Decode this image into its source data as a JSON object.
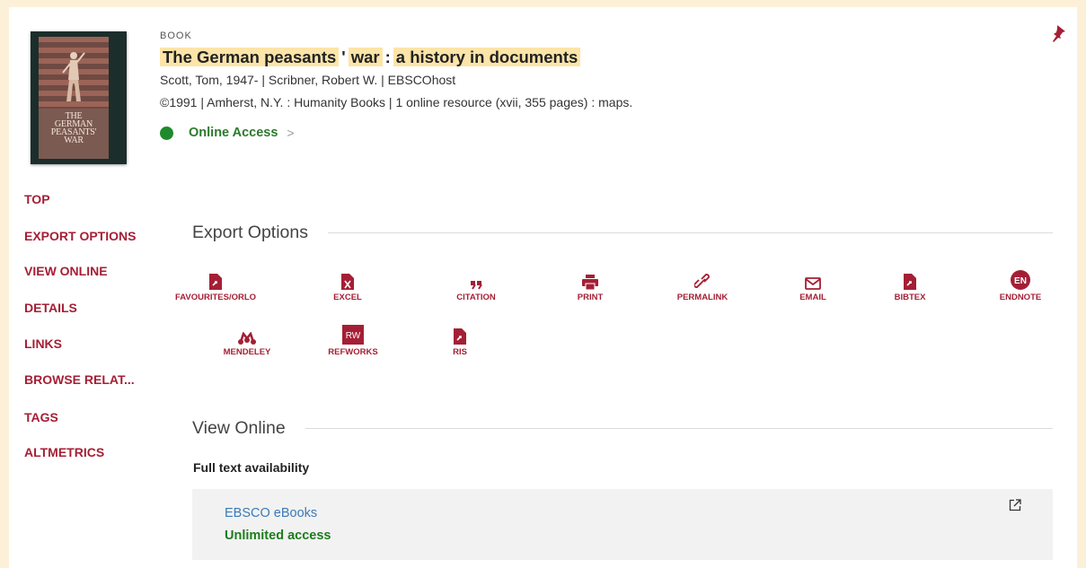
{
  "record": {
    "type": "BOOK",
    "title_parts": [
      "The German peasants",
      "'",
      "war",
      ":",
      "a history in documents"
    ],
    "authors": "Scott, Tom, 1947- | Scribner, Robert W. | EBSCOhost",
    "publication": "©1991 | Amherst, N.Y. : Humanity Books | 1 online resource (xvii, 355 pages) : maps.",
    "access_label": "Online Access",
    "access_chevron": ">",
    "access_color": "#1e8a2d"
  },
  "cover": {
    "title_lines": [
      "THE",
      "GERMAN",
      "PEASANTS'",
      "WAR"
    ]
  },
  "nav": {
    "items": [
      {
        "label": "TOP"
      },
      {
        "label": "EXPORT OPTIONS"
      },
      {
        "label": "VIEW ONLINE"
      },
      {
        "label": "DETAILS"
      },
      {
        "label": "LINKS"
      },
      {
        "label": "BROWSE RELAT..."
      },
      {
        "label": "TAGS"
      },
      {
        "label": "ALTMETRICS"
      }
    ]
  },
  "export": {
    "heading": "Export Options",
    "items": [
      {
        "label": "FAVOURITES/ORLO",
        "icon": "file-export-icon"
      },
      {
        "label": "EXCEL",
        "icon": "excel-icon"
      },
      {
        "label": "CITATION",
        "icon": "quote-icon"
      },
      {
        "label": "PRINT",
        "icon": "printer-icon"
      },
      {
        "label": "PERMALINK",
        "icon": "link-icon"
      },
      {
        "label": "EMAIL",
        "icon": "envelope-icon"
      },
      {
        "label": "BIBTEX",
        "icon": "file-export-icon"
      },
      {
        "label": "ENDNOTE",
        "icon": "endnote-icon",
        "badge": "EN"
      },
      {
        "label": "MENDELEY",
        "icon": "mendeley-icon"
      },
      {
        "label": "REFWORKS",
        "icon": "refworks-icon",
        "badge": "RW"
      },
      {
        "label": "RIS",
        "icon": "file-export-icon"
      }
    ]
  },
  "view_online": {
    "heading": "View Online",
    "subheading": "Full text availability",
    "provider": "EBSCO eBooks",
    "availability": "Unlimited access"
  },
  "colors": {
    "accent": "#a41f35",
    "highlight": "#fde4a8",
    "frame": "#fcf1d8",
    "link": "#3a7ab8",
    "available": "#1e7b1e"
  }
}
